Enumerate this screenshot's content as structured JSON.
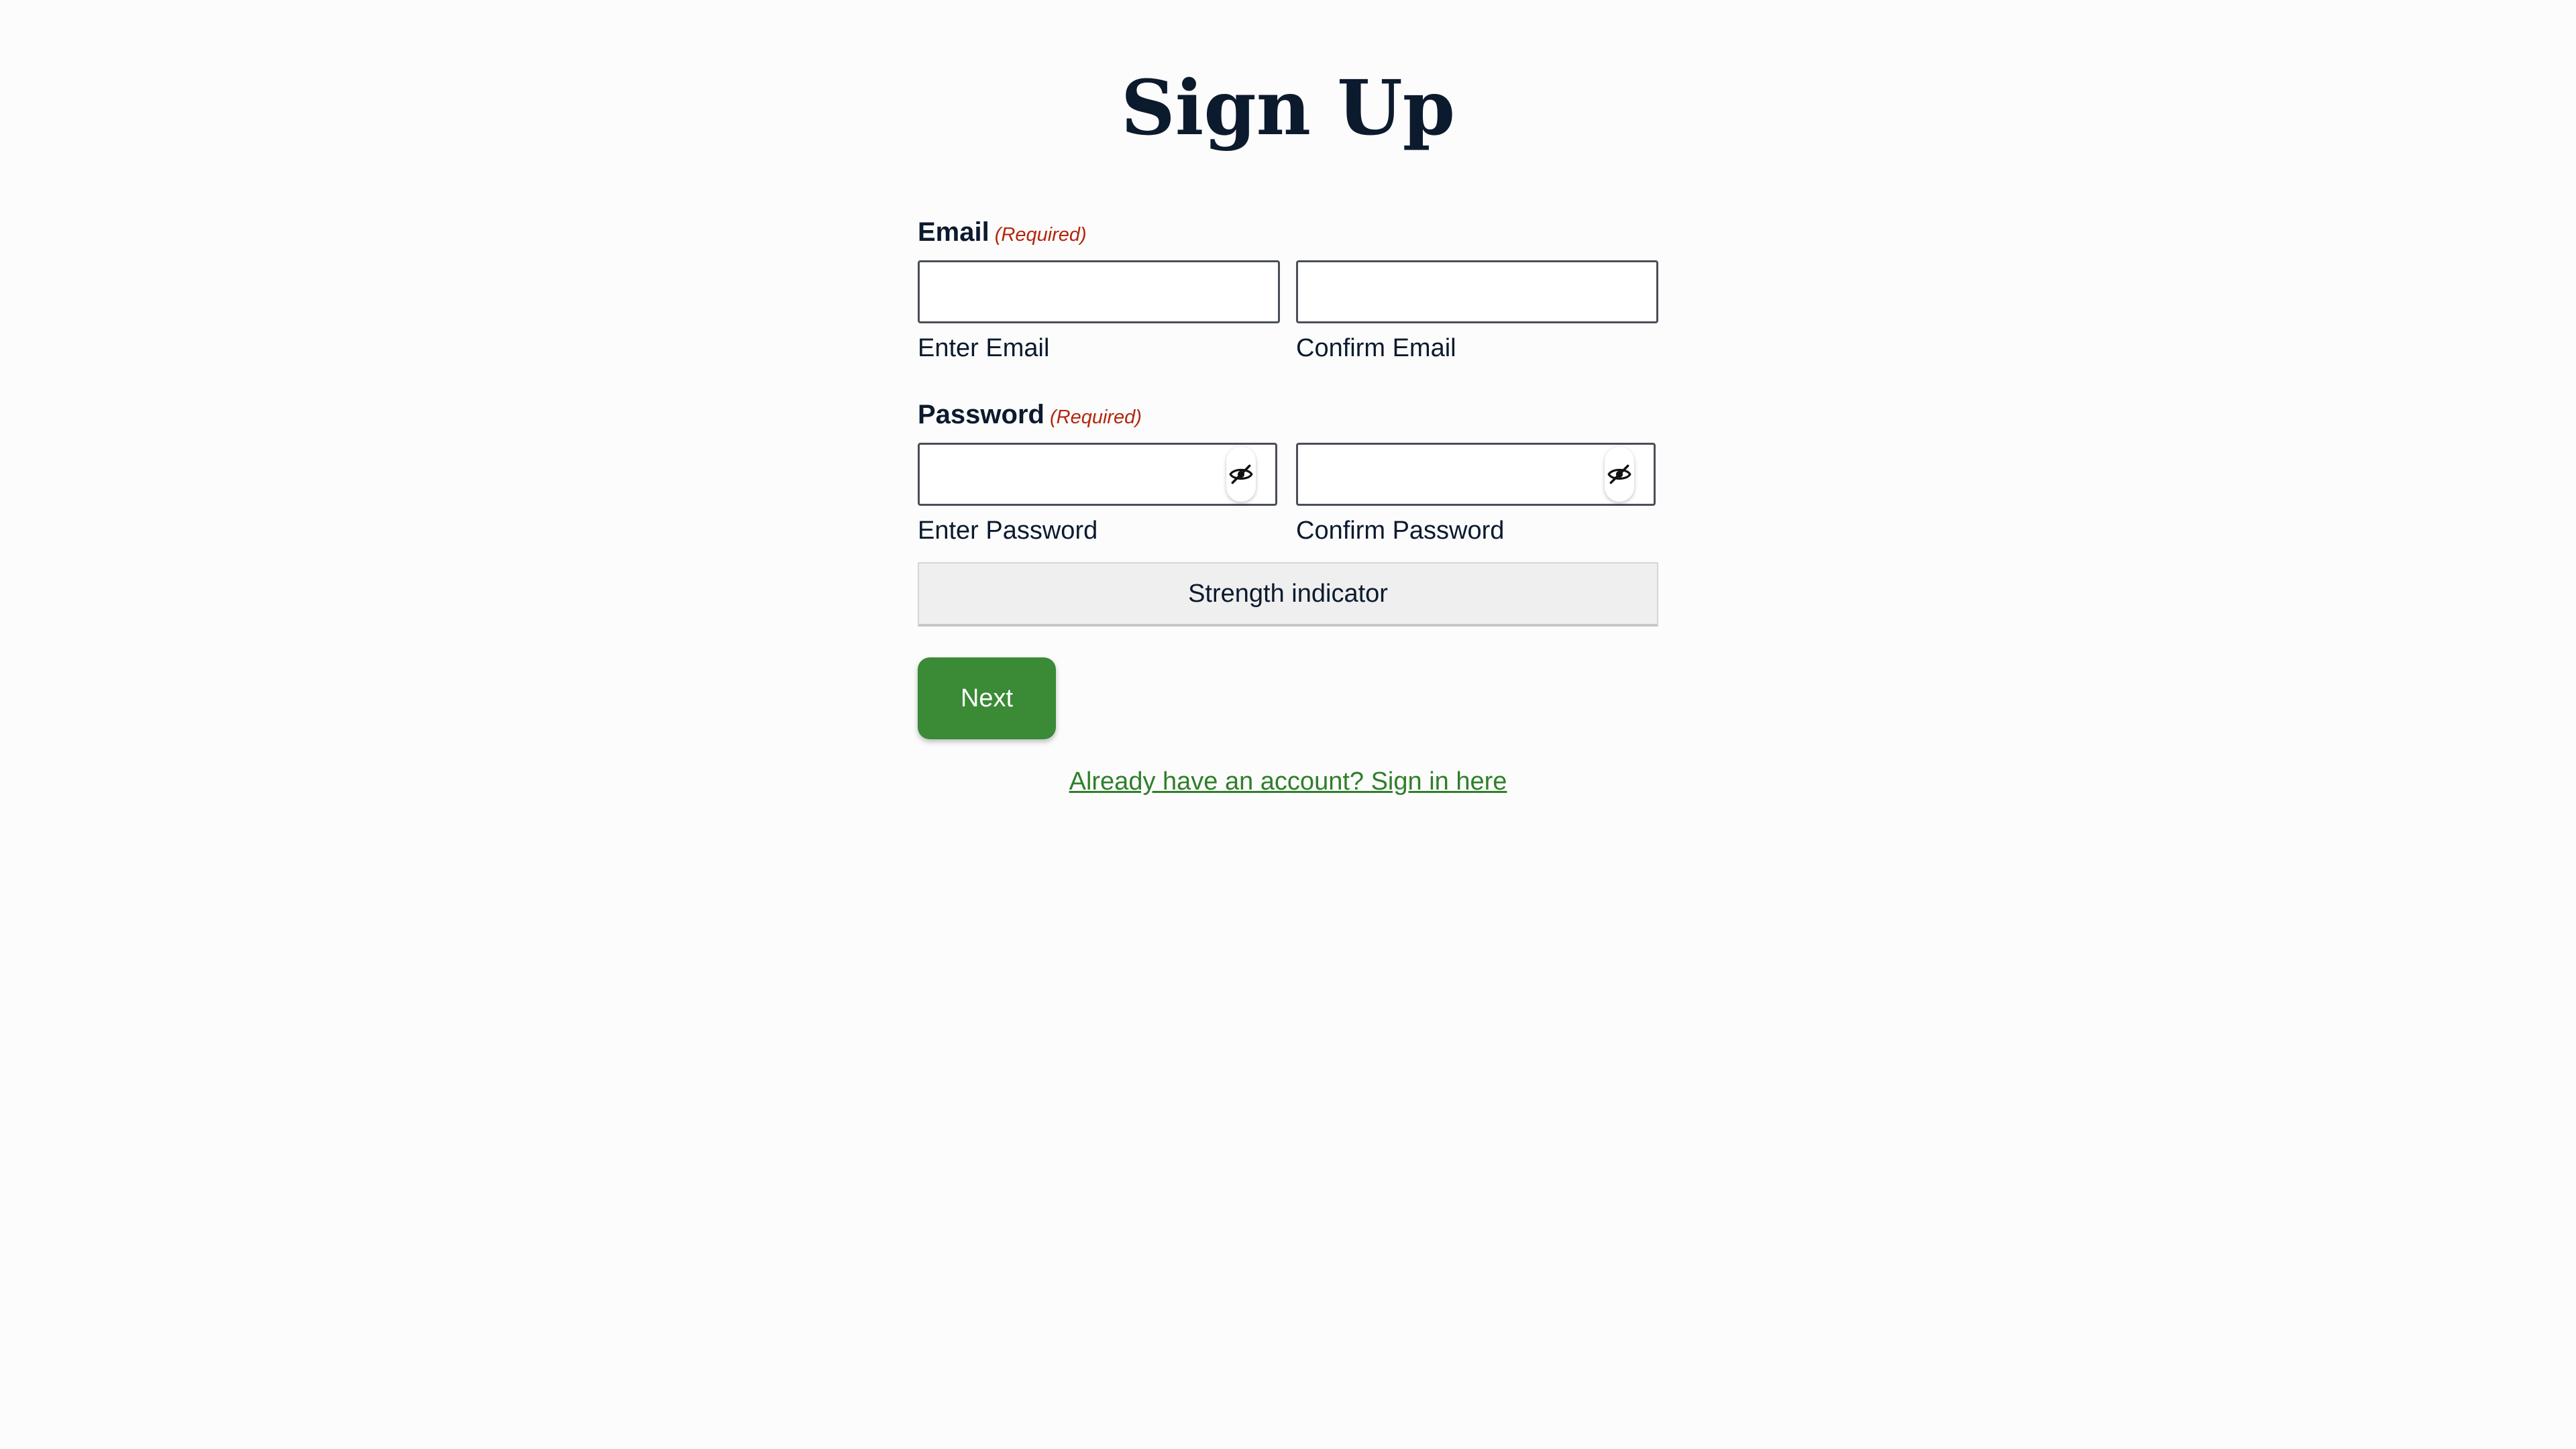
{
  "page": {
    "title": "Sign Up"
  },
  "email": {
    "legend": "Email",
    "required": "(Required)",
    "enter_label": "Enter Email",
    "enter_value": "",
    "confirm_label": "Confirm Email",
    "confirm_value": ""
  },
  "password": {
    "legend": "Password",
    "required": "(Required)",
    "enter_label": "Enter Password",
    "enter_value": "",
    "confirm_label": "Confirm Password",
    "confirm_value": "",
    "toggle_icon": "eye-slash-icon"
  },
  "strength": {
    "label": "Strength indicator"
  },
  "actions": {
    "next_label": "Next",
    "signin_link": "Already have an account? Sign in here"
  },
  "colors": {
    "primary": "#3a8a36",
    "link": "#2f7f2a",
    "required": "#b3260f",
    "text": "#0c1a2e",
    "background": "#fcfcfc"
  }
}
